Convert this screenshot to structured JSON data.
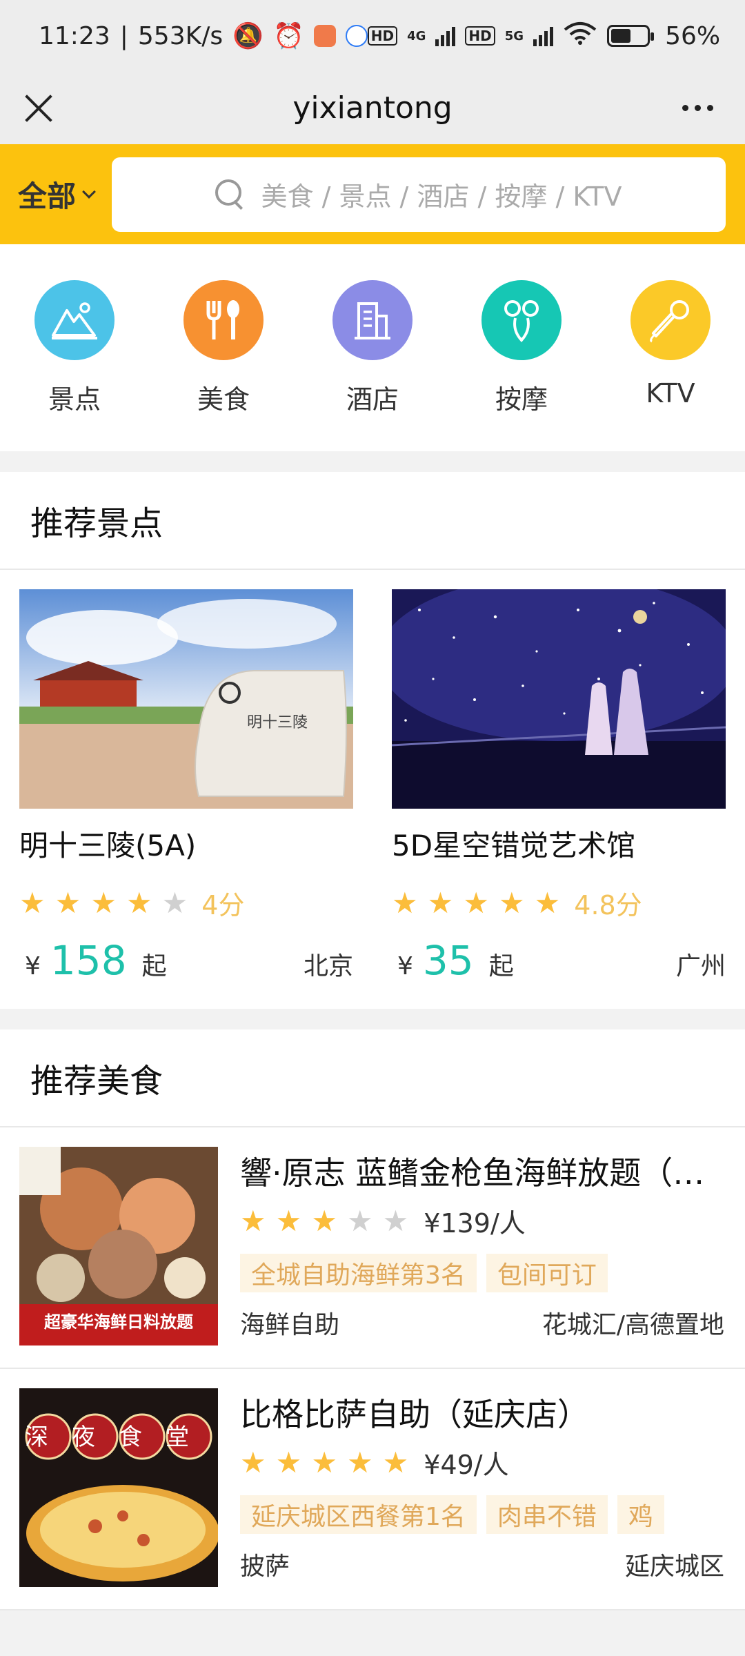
{
  "status": {
    "time": "11:23",
    "speed": "553K/s",
    "hd1": "HD",
    "net1": "4G",
    "hd2": "HD",
    "net2": "5G",
    "battery": "56%"
  },
  "nav": {
    "title": "yixiantong"
  },
  "search": {
    "scope": "全部",
    "placeholder": "美食 / 景点 / 酒店 / 按摩 / KTV"
  },
  "categories": [
    {
      "label": "景点",
      "icon": "mountain-icon",
      "color": "#4cc3e8"
    },
    {
      "label": "美食",
      "icon": "fork-spoon-icon",
      "color": "#f79131"
    },
    {
      "label": "酒店",
      "icon": "building-icon",
      "color": "#8b8ce6"
    },
    {
      "label": "按摩",
      "icon": "massage-icon",
      "color": "#16c7b4"
    },
    {
      "label": "KTV",
      "icon": "microphone-icon",
      "color": "#fbc928"
    }
  ],
  "spots_section": {
    "title": "推荐景点",
    "items": [
      {
        "name": "明十三陵(5A)",
        "rating": "4分",
        "stars": 4,
        "yen": "¥",
        "price": "158",
        "suffix": "起",
        "city": "北京"
      },
      {
        "name": "5D星空错觉艺术馆",
        "rating": "4.8分",
        "stars": 5,
        "yen": "¥",
        "price": "35",
        "suffix": "起",
        "city": "广州"
      }
    ]
  },
  "food_section": {
    "title": "推荐美食",
    "items": [
      {
        "name": "響·原志 蓝鳍金枪鱼海鲜放题（花城汇店）",
        "stars": 3,
        "per": "¥139/人",
        "tags": [
          "全城自助海鲜第3名",
          "包间可订"
        ],
        "type": "海鲜自助",
        "area": "花城汇/高德置地",
        "img_text": "超豪华海鲜日料放题"
      },
      {
        "name": "比格比萨自助（延庆店）",
        "stars": 5,
        "per": "¥49/人",
        "tags": [
          "延庆城区西餐第1名",
          "肉串不错",
          "鸡"
        ],
        "type": "披萨",
        "area": "延庆城区",
        "img_text": "深夜食堂"
      }
    ]
  },
  "colors": {
    "accent": "#fcc20e",
    "price": "#1ec0aa",
    "star": "#fbbd3b"
  }
}
